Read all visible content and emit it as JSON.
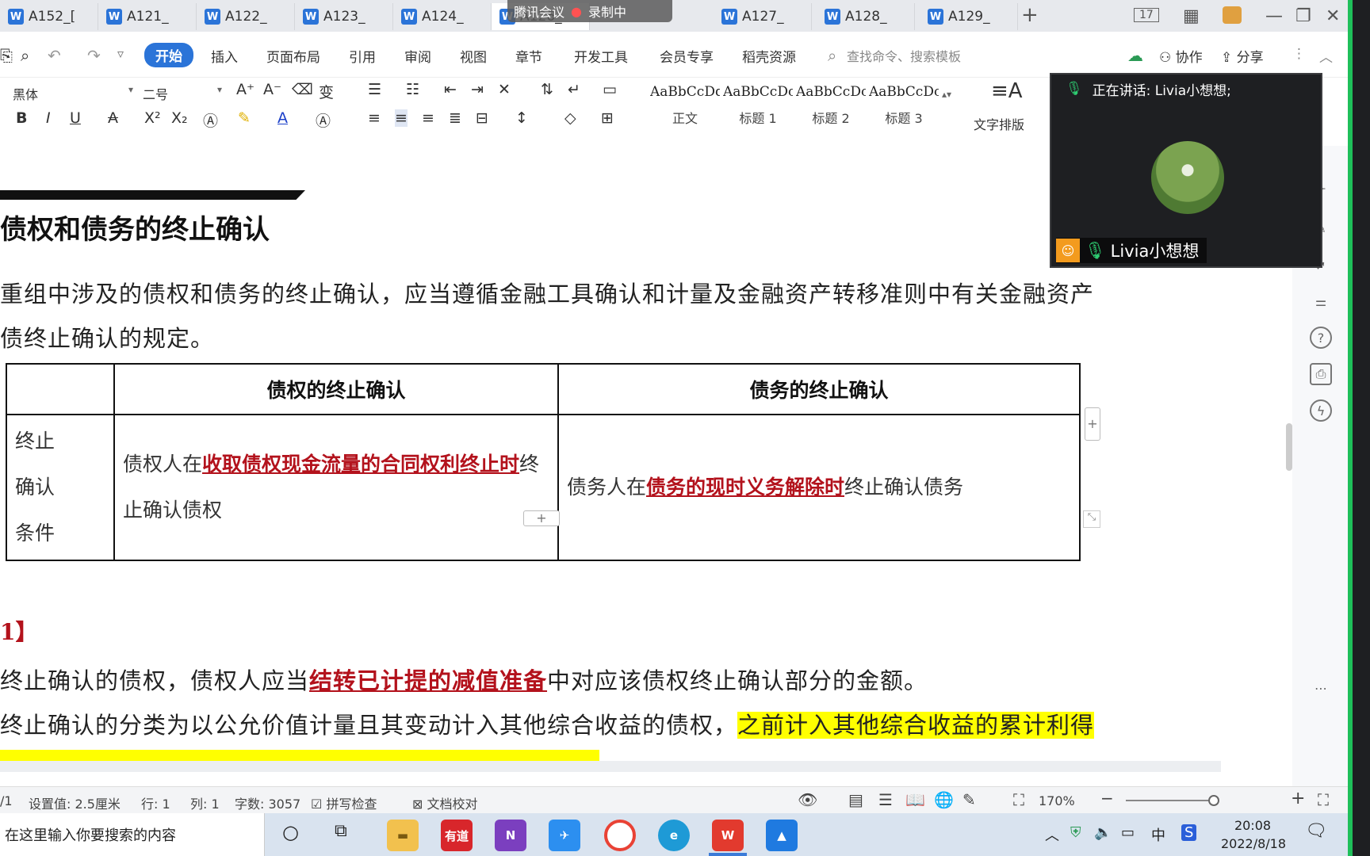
{
  "tabs": [
    {
      "label": "A152_[",
      "active": false
    },
    {
      "label": "A121_",
      "active": false
    },
    {
      "label": "A122_",
      "active": false
    },
    {
      "label": "A123_",
      "active": false
    },
    {
      "label": "A124_",
      "active": false
    },
    {
      "label": "A126_",
      "active": true
    },
    {
      "label": "A127_",
      "active": false
    },
    {
      "label": "A128_",
      "active": false
    },
    {
      "label": "A129_",
      "active": false
    }
  ],
  "meeting": {
    "app": "腾讯会议",
    "recording": "录制中"
  },
  "window": {
    "counter": "17"
  },
  "menu": {
    "items": [
      "开始",
      "插入",
      "页面布局",
      "引用",
      "审阅",
      "视图",
      "章节",
      "开发工具",
      "会员专享",
      "稻壳资源"
    ],
    "search_placeholder": "查找命令、搜索模板",
    "collab": "协作",
    "share": "分享"
  },
  "ribbon": {
    "font": "黑体",
    "size": "二号",
    "styles": [
      {
        "sample": "AaBbCcDd",
        "name": "正文"
      },
      {
        "sample": "AaBbCcDc",
        "name": "标题 1"
      },
      {
        "sample": "AaBbCcDc",
        "name": "标题 2"
      },
      {
        "sample": "AaBbCcDc",
        "name": "标题 3"
      }
    ],
    "layout_label": "文字排版"
  },
  "video": {
    "speaking_label": "正在讲话: Livia小想想;",
    "name": "Livia小想想"
  },
  "doc": {
    "title": "债权和债务的终止确认",
    "para1_line1": "重组中涉及的债权和债务的终止确认，应当遵循金融工具确认和计量及金融资产转移准则中有关金融资产",
    "para1_line2": "债终止确认的规定。",
    "table": {
      "headers": [
        "",
        "债权的终止确认",
        "债务的终止确认"
      ],
      "row_header_lines": [
        "终止",
        "确认",
        "条件"
      ],
      "cell1_pre": "债权人在",
      "cell1_key": "收取债权现金流量的合同权利终止时",
      "cell1_post": "终止确认债权",
      "cell2_pre": "债务人在",
      "cell2_key": "债务的现时义务解除时",
      "cell2_post": "终止确认债务"
    },
    "example_label": "1】",
    "line1_pre": "终止确认的债权，债权人应当",
    "line1_key": "结转已计提的减值准备",
    "line1_post": "中对应该债权终止确认部分的金额。",
    "line2_pre": "终止确认的分类为以公允价值计量且其变动计入其他综合收益的债权，",
    "line2_hl": "之前计入其他综合收益的累计利得"
  },
  "status": {
    "page": "/1",
    "setting": "设置值: 2.5厘米",
    "row": "行: 1",
    "col": "列: 1",
    "words": "字数: 3057",
    "spell": "拼写检查",
    "proof": "文档校对",
    "zoom": "170%"
  },
  "taskbar": {
    "search": "在这里输入你要搜索的内容",
    "input_lang": "中",
    "time": "20:08",
    "date": "2022/8/18"
  }
}
